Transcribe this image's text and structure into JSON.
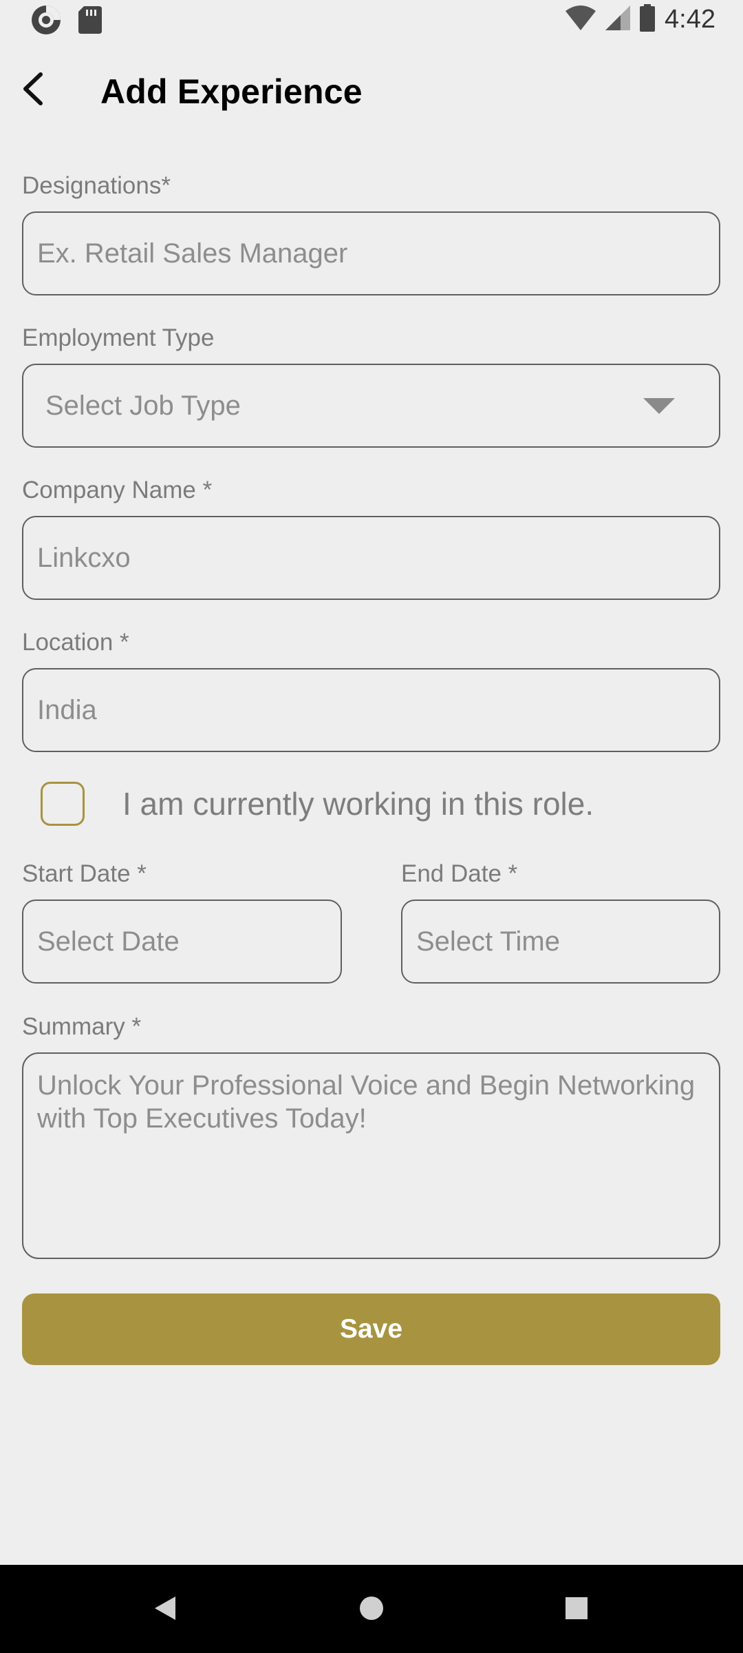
{
  "status_bar": {
    "time": "4:42",
    "left_icons": [
      "app-logo-icon",
      "sd-card-icon"
    ],
    "right_icons": [
      "wifi-icon",
      "signal-icon",
      "battery-icon"
    ]
  },
  "header": {
    "title": "Add Experience"
  },
  "form": {
    "designation": {
      "label": "Designations*",
      "placeholder": "Ex. Retail Sales Manager"
    },
    "employment_type": {
      "label": "Employment Type",
      "selected": "Select Job Type"
    },
    "company_name": {
      "label": "Company Name *",
      "placeholder": "Linkcxo"
    },
    "location": {
      "label": "Location *",
      "placeholder": "India"
    },
    "currently_working": {
      "label": "I am currently working in this role.",
      "checked": false
    },
    "start_date": {
      "label": "Start Date *",
      "placeholder": "Select Date"
    },
    "end_date": {
      "label": "End Date *",
      "placeholder": "Select Time"
    },
    "summary": {
      "label": "Summary *",
      "placeholder": "Unlock Your Professional Voice and Begin Networking with Top Executives Today!"
    },
    "save_label": "Save"
  },
  "colors": {
    "accent": "#a89440",
    "background": "#eeeeee",
    "border": "#5f5f5f",
    "label": "#7b7b7b"
  }
}
